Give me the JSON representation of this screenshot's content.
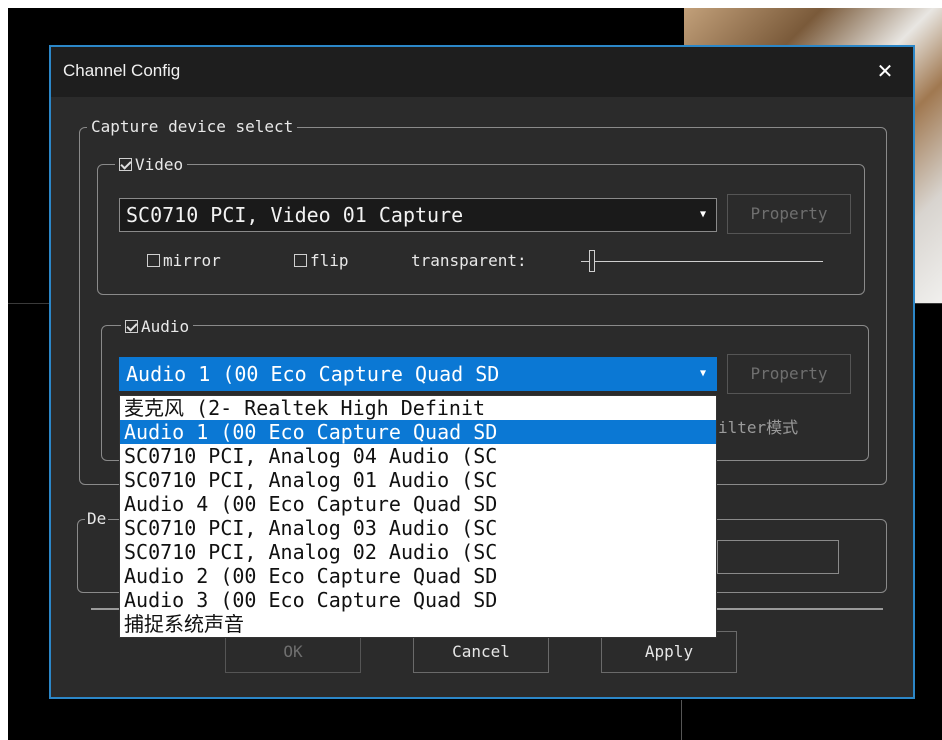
{
  "dialog": {
    "title": "Channel Config",
    "close_icon": "close-icon"
  },
  "capture": {
    "legend": "Capture device select",
    "video": {
      "label": "Video",
      "checked": true,
      "device": "SC0710 PCI, Video 01 Capture",
      "property": "Property",
      "mirror": "mirror",
      "flip": "flip",
      "transparent": "transparent:"
    },
    "audio": {
      "label": "Audio",
      "checked": true,
      "device": "Audio 1 (00 Eco Capture Quad SD",
      "property": "Property",
      "filter_partial": "ilter模式",
      "options": [
        "麦克风 (2- Realtek High Definit",
        "Audio 1 (00 Eco Capture Quad SD",
        "SC0710 PCI, Analog 04 Audio (SC",
        "SC0710 PCI, Analog 01 Audio (SC",
        "Audio 4 (00 Eco Capture Quad SD",
        "SC0710 PCI, Analog 03 Audio (SC",
        "SC0710 PCI, Analog 02 Audio (SC",
        "Audio 2 (00 Eco Capture Quad SD",
        "Audio 3 (00 Eco Capture Quad SD",
        "捕捉系统声音"
      ],
      "selected_index": 1
    }
  },
  "dest": {
    "legend_partial": "De"
  },
  "footer": {
    "ok": "OK",
    "cancel": "Cancel",
    "apply": "Apply"
  },
  "colors": {
    "accent": "#2c87c8",
    "selection": "#0b78d4",
    "dialog_bg": "#2b2b2b"
  }
}
